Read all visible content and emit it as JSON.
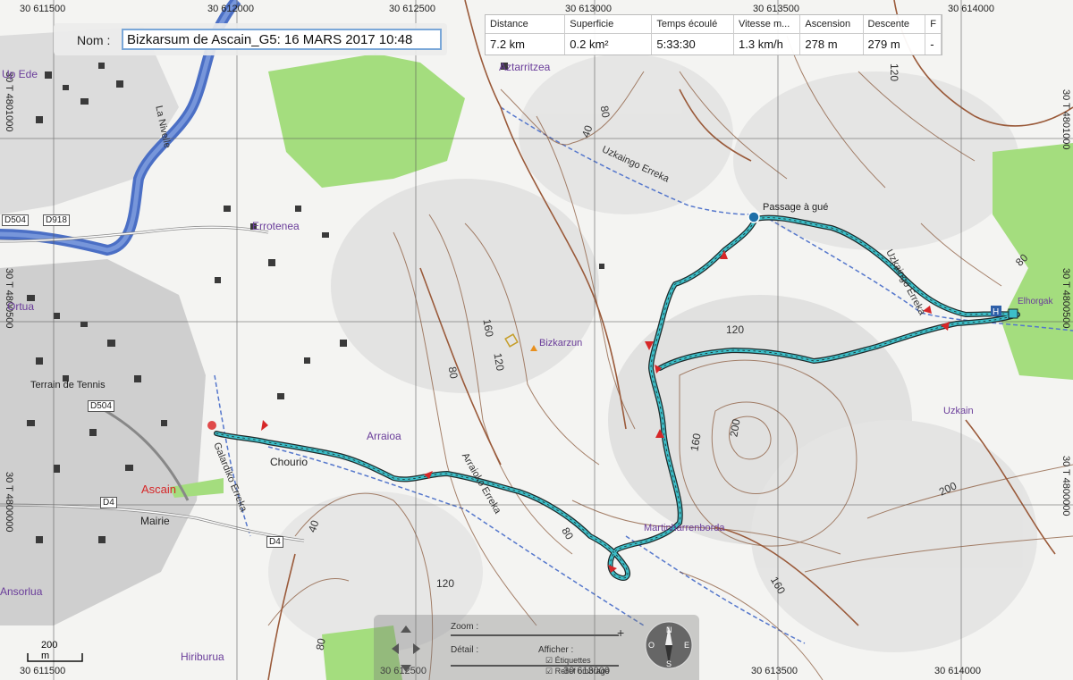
{
  "name_label": "Nom :",
  "name_value": "Bizkarsum de Ascain_G5: 16 MARS 2017 10:48",
  "stats": {
    "headers": [
      "Distance",
      "Superficie",
      "Temps écoulé",
      "Vitesse m...",
      "Ascension",
      "Descente",
      "F"
    ],
    "values": [
      "7.2 km",
      "0.2 km²",
      "5:33:30",
      "1.3 km/h",
      "278 m",
      "279 m",
      "-"
    ]
  },
  "grid": {
    "top_x": [
      "30 611500",
      "30 612000",
      "30 612500",
      "30 613000",
      "30 613500",
      "30 614000"
    ],
    "bottom_x": [
      "30 611500",
      "30 612500",
      "30 613000",
      "30 613500",
      "30 614000"
    ],
    "left_y": [
      "30 T 4801000",
      "30 T 4800500",
      "30 T 4800000"
    ],
    "right_y": [
      "30 T 4801000",
      "30 T 4800500",
      "30 T 4800000"
    ]
  },
  "places": {
    "aztarritzea": "Aztarritzea",
    "errotenea": "Errotenea",
    "bizkarzun": "Bizkarzun",
    "arraioa": "Arraioa",
    "chourio": "Chourio",
    "ascain": "Ascain",
    "mairie": "Mairie",
    "terrain": "Terrain de Tennis",
    "martinhar": "Martinharrenborda",
    "passage": "Passage à gué",
    "elhorgak": "Elhorgak",
    "uzkain": "Uzkain",
    "hiriburua": "Hiriburua",
    "ansorlua": "Ansorlua",
    "ortua": "Ortua",
    "uphede": "Up Ede"
  },
  "rivers": {
    "uzkaingo": "Uzkaingo Erreka",
    "uzkaingo2": "Uzkaingo Erreka",
    "arraioko": "Arraioko Erreka",
    "galardiko": "Galardiko Erreka",
    "nivelle": "La Nivelle"
  },
  "roads": {
    "d504a": "D504",
    "d918": "D918",
    "d504b": "D504",
    "d4a": "D4",
    "d4b": "D4"
  },
  "contours": [
    "40",
    "80",
    "160",
    "120",
    "80",
    "120",
    "160",
    "200",
    "200",
    "160",
    "80",
    "120",
    "40",
    "120",
    "80",
    "80",
    "120"
  ],
  "scale_label": "200 m",
  "controls": {
    "zoom_label": "Zoom :",
    "detail_label": "Détail :",
    "afficher_label": "Afficher :",
    "opt1": "Étiquettes",
    "opt2": "Relief ombragé"
  },
  "colors": {
    "track": "#3dbfc9",
    "forest": "#a4dd7e",
    "water": "#4b6fc5",
    "contour": "#8b5a3c",
    "arrow": "#d62728"
  }
}
